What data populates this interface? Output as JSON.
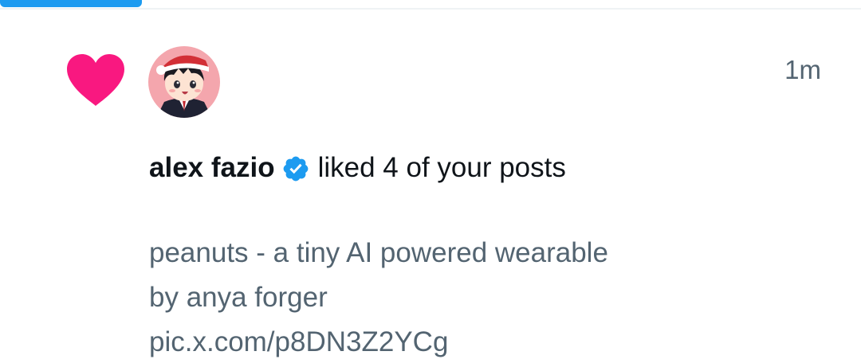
{
  "tab_bar": {
    "active_indicator_color": "#1d9bf0"
  },
  "notification": {
    "type_icon": "heart-icon",
    "type_icon_color": "#f91880",
    "avatar": "avatar-cartoon-boy-santa-hat",
    "timestamp": "1m",
    "user_name": "alex fazio",
    "verified_icon": "verified-badge-icon",
    "verified_color": "#1d9bf0",
    "action_text": "liked 4 of your posts",
    "post_preview": {
      "line1": "peanuts - a tiny AI powered wearable",
      "line2": "by anya forger",
      "link": "pic.x.com/p8DN3Z2YCg"
    }
  }
}
